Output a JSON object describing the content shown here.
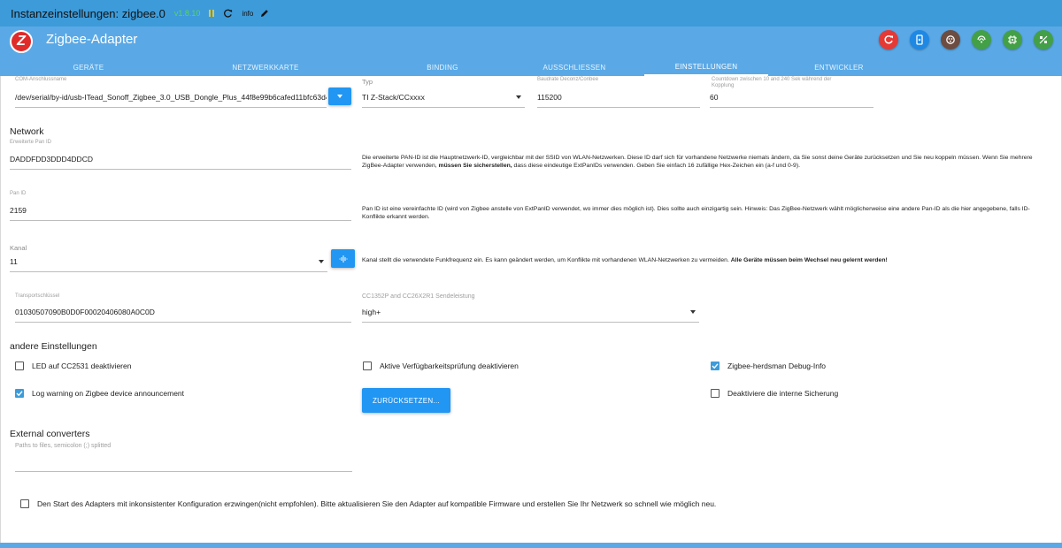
{
  "topbar": {
    "title": "Instanzeinstellungen: zigbee.0",
    "version": "v1.8.10",
    "info": "info",
    "icons": [
      "pause-icon",
      "reload-icon",
      "info-icon",
      "edit-icon"
    ]
  },
  "header": {
    "logo_letter": "Z",
    "app_name": "Zigbee-Adapter",
    "buttons": [
      {
        "name": "reset-button",
        "color": "#e53935"
      },
      {
        "name": "pairing-button",
        "color": "#1e88e5"
      },
      {
        "name": "touchlink-button",
        "color": "#6d4c41"
      },
      {
        "name": "scan-button",
        "color": "#43a047"
      },
      {
        "name": "chip-button",
        "color": "#43a047"
      },
      {
        "name": "info-button",
        "color": "#43a047"
      }
    ]
  },
  "tabs": [
    {
      "label": "GERÄTE"
    },
    {
      "label": "NETZWERKKARTE"
    },
    {
      "label": "BINDING"
    },
    {
      "label": "AUSSCHLIESSEN"
    },
    {
      "label": "EINSTELLUNGEN",
      "active": true
    },
    {
      "label": "ENTWICKLER"
    }
  ],
  "serial": {
    "com_label": "COM-Anschlussname",
    "com_value": "/dev/serial/by-id/usb-ITead_Sonoff_Zigbee_3.0_USB_Dongle_Plus_44f8e99b6cafed11bfc63d4e71c",
    "typ_label": "Typ",
    "typ_value": "TI Z-Stack/CCxxxx",
    "baud_label": "Baudrate Deconz/Conbee",
    "baud_value": "115200",
    "countdown_label": "Countdown zwischen 10 and 240 Sek während der Kopplung",
    "countdown_value": "60"
  },
  "network": {
    "heading": "Network",
    "extpan_label": "Erweiterte Pan ID",
    "extpan_value": "DADDFDD3DDD4DDCD",
    "extpan_desc_1": "Die erweiterte PAN-ID ist die Hauptnetzwerk-ID, vergleichbar mit der SSID von WLAN-Netzwerken. Diese ID darf sich für vorhandene Netzwerke niemals ändern, da Sie sonst deine Geräte zurücksetzen und Sie neu koppeln müssen. Wenn Sie mehrere ZigBee-Adapter verwenden, ",
    "extpan_desc_bold": "müssen Sie sicherstellen,",
    "extpan_desc_2": " dass diese eindeutige ExtPanIDs verwenden. Geben Sie einfach 16 zufällige Hex-Zeichen ein (a-f und 0-9).",
    "pan_label": "Pan ID",
    "pan_value": "2159",
    "pan_desc": "Pan ID ist eine vereinfachte ID (wird von Zigbee anstelle von ExtPanID verwendet, wo immer dies möglich ist). Dies sollte auch einzigartig sein. Hinweis: Das ZigBee-Netzwerk wählt möglicherweise eine andere Pan-ID als die hier angegebene, falls ID-Konflikte erkannt werden.",
    "kanal_label": "Kanal",
    "kanal_value": "11",
    "kanal_desc_1": "Kanal stellt die verwendete Funkfrequenz ein. Es kann geändert werden, um Konflikte mit vorhandenen WLAN-Netzwerken zu vermeiden. ",
    "kanal_desc_bold": "Alle Geräte müssen beim Wechsel neu gelernt werden!",
    "transport_label": "Transportschlüssel",
    "transport_value": "01030507090B0D0F00020406080A0C0D",
    "power_label": "CC1352P and CC26X2R1 Sendeleistung",
    "power_value": "high+"
  },
  "other": {
    "heading": "andere Einstellungen",
    "checkboxes": [
      {
        "label": "LED auf CC2531 deaktivieren",
        "checked": false
      },
      {
        "label": "Aktive Verfügbarkeitsprüfung deaktivieren",
        "checked": false
      },
      {
        "label": "Zigbee-herdsman Debug-Info",
        "checked": true
      },
      {
        "label": "Log warning on Zigbee device announcement",
        "checked": true
      },
      {
        "label": "Deaktiviere die interne Sicherung",
        "checked": false
      }
    ],
    "reset_label": "ZURÜCKSETZEN..."
  },
  "external": {
    "heading": "External converters",
    "placeholder": "Paths to files, semicolon (;) splitted",
    "value": ""
  },
  "force": {
    "label": "Den Start des Adapters mit inkonsistenter Konfiguration erzwingen(nicht empfohlen). Bitte aktualisieren Sie den Adapter auf kompatible Firmware und erstellen Sie Ihr Netzwerk so schnell wie möglich neu.",
    "checked": false
  }
}
